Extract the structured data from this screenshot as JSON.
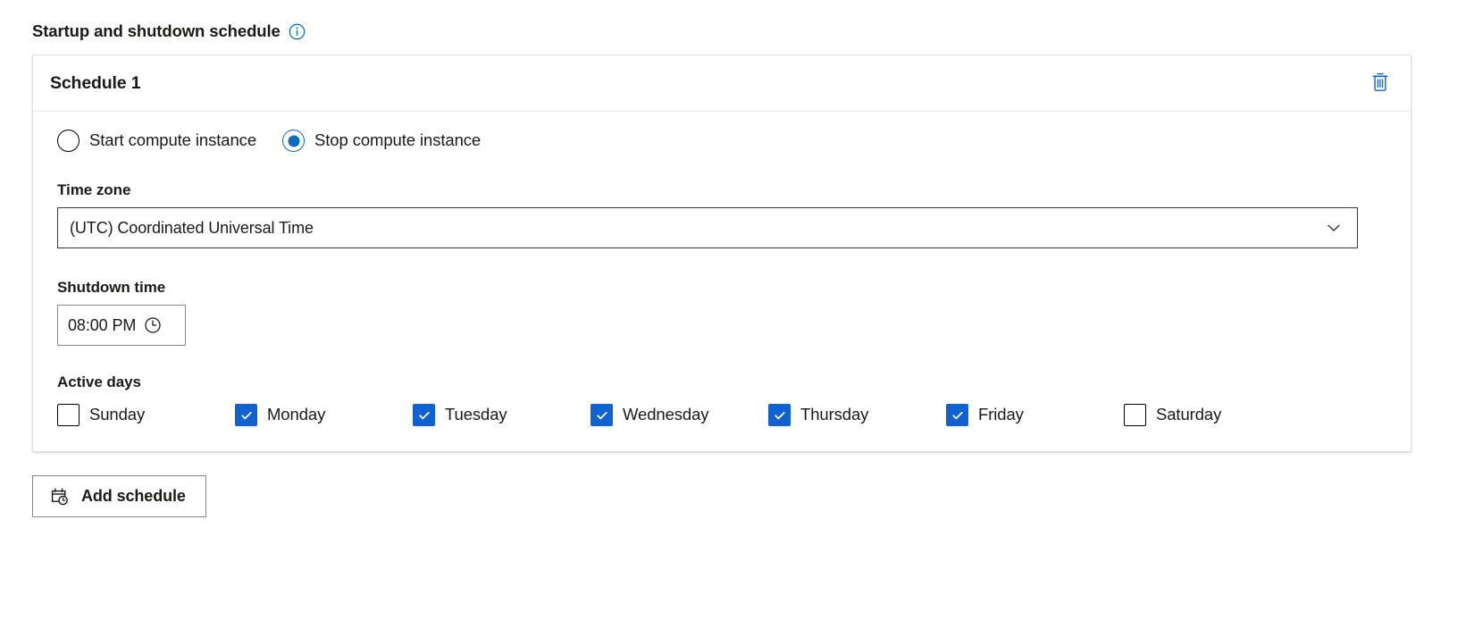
{
  "section": {
    "heading": "Startup and shutdown schedule",
    "info_icon": "info-circle-icon"
  },
  "schedule_card": {
    "title": "Schedule 1",
    "delete_icon": "trash-icon",
    "action": {
      "selected": "stop",
      "options": [
        {
          "id": "start",
          "label": "Start compute instance",
          "selected": false
        },
        {
          "id": "stop",
          "label": "Stop compute instance",
          "selected": true
        }
      ]
    },
    "time_zone": {
      "label": "Time zone",
      "value": "(UTC) Coordinated Universal Time",
      "chevron_icon": "chevron-down-icon"
    },
    "shutdown_time": {
      "label": "Shutdown time",
      "value": "08:00 PM",
      "clock_icon": "clock-icon"
    },
    "active_days": {
      "label": "Active days",
      "days": [
        {
          "label": "Sunday",
          "checked": false
        },
        {
          "label": "Monday",
          "checked": true
        },
        {
          "label": "Tuesday",
          "checked": true
        },
        {
          "label": "Wednesday",
          "checked": true
        },
        {
          "label": "Thursday",
          "checked": true
        },
        {
          "label": "Friday",
          "checked": true
        },
        {
          "label": "Saturday",
          "checked": false
        }
      ]
    }
  },
  "add_schedule": {
    "label": "Add schedule",
    "icon": "calendar-clock-icon"
  },
  "colors": {
    "accent_blue": "#0f6cbd",
    "checkbox_blue": "#0f62d0",
    "text": "#1b1a19",
    "border": "#8a8886",
    "card_border": "#e1dfdd"
  }
}
